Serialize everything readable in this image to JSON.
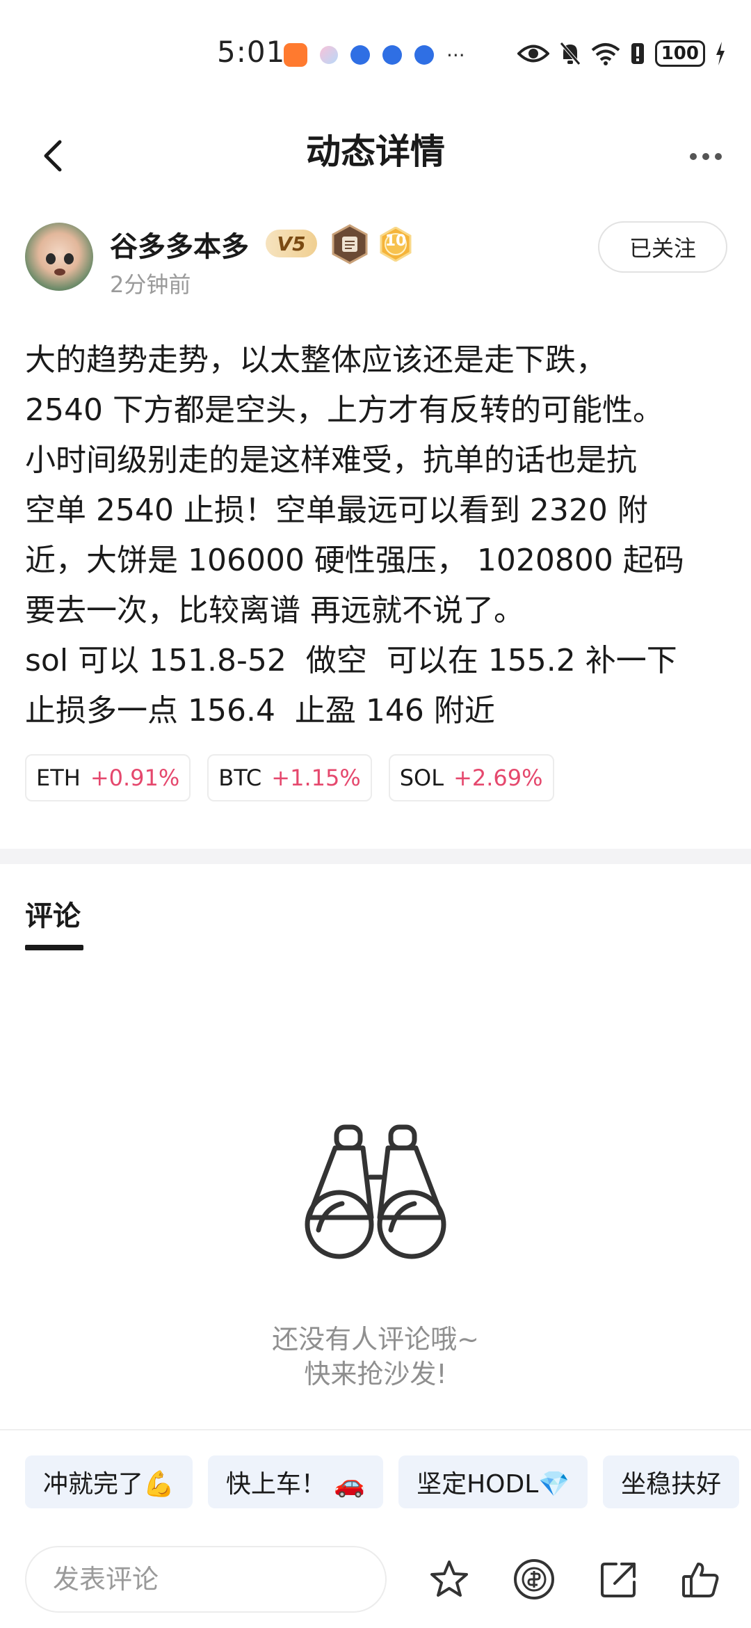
{
  "status_bar": {
    "time": "5:01",
    "battery": "100",
    "more_indicator": "···"
  },
  "header": {
    "title": "动态详情"
  },
  "author": {
    "name": "谷多多本多",
    "vip": "V5",
    "level": "10",
    "time_ago": "2分钟前",
    "follow_label": "已关注"
  },
  "post": {
    "body": "大的趋势走势，以太整体应该还是走下跌，\n2540 下方都是空头，上方才有反转的可能性。\n小时间级别走的是这样难受，抗单的话也是抗\n空单 2540 止损！空单最远可以看到 2320 附\n近，大饼是 106000 硬性强压， 1020800 起码\n要去一次，比较离谱 再远就不说了。\nsol 可以 151.8-52  做空  可以在 155.2 补一下\n止损多一点 156.4  止盈 146 附近"
  },
  "tags": [
    {
      "symbol": "ETH",
      "change": "+0.91%"
    },
    {
      "symbol": "BTC",
      "change": "+1.15%"
    },
    {
      "symbol": "SOL",
      "change": "+2.69%"
    }
  ],
  "comments": {
    "tab_label": "评论",
    "empty_line1": "还没有人评论哦~",
    "empty_line2": "快来抢沙发!"
  },
  "quick_replies": [
    "冲就完了💪",
    "快上车！ 🚗",
    "坚定HODL💎",
    "坐稳扶好"
  ],
  "bottom_bar": {
    "input_placeholder": "发表评论"
  },
  "colors": {
    "positive_change": "#e5486d",
    "chip_background": "#eef3fb",
    "vip_gold": "#f0cf91"
  },
  "icons": [
    "back-icon",
    "more-icon",
    "binoculars-icon",
    "star-icon",
    "coin-icon",
    "share-icon",
    "thumbs-up-icon"
  ]
}
